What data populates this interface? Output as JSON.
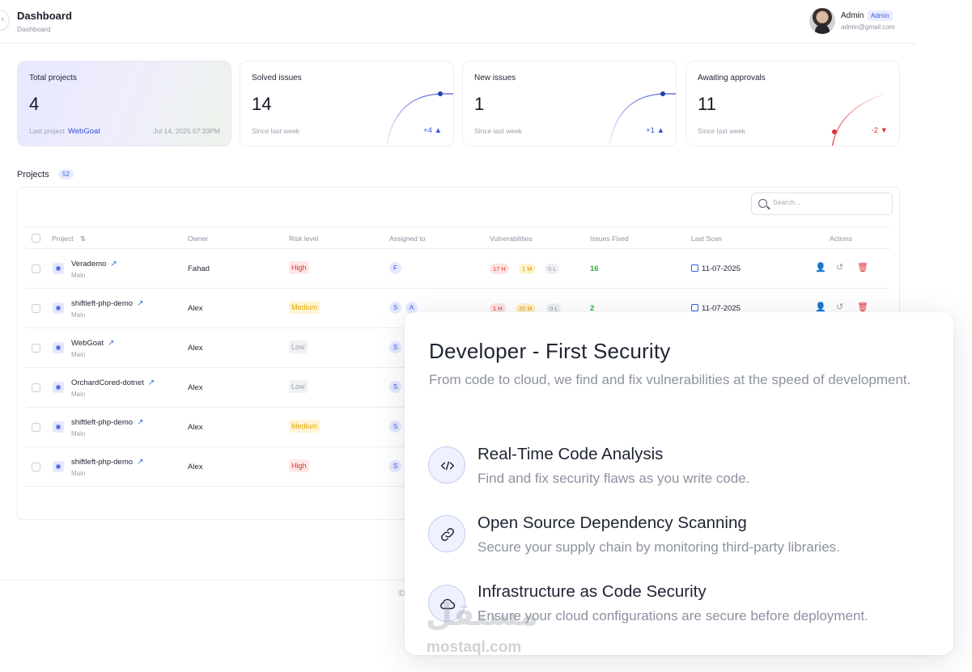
{
  "header": {
    "back_glyph": "‹",
    "title": "Dashboard",
    "breadcrumb": "Dashboard",
    "user": {
      "name": "Admin",
      "role_badge": "Admin",
      "email": "admin@gmail.com"
    }
  },
  "stats": {
    "total": {
      "label": "Total projects",
      "value": "4",
      "last_label": "Last project",
      "last_link": "WebGoat",
      "date": "Jul 14, 2025 07:33PM"
    },
    "solved": {
      "label": "Solved issues",
      "value": "14",
      "sub": "Since last week",
      "delta": "+4 ▲",
      "accent": "#3b4fd8"
    },
    "new": {
      "label": "New issues",
      "value": "1",
      "sub": "Since last week",
      "delta": "+1 ▲",
      "accent": "#3b4fd8"
    },
    "awaiting": {
      "label": "Awaiting approvals",
      "value": "11",
      "sub": "Since last week",
      "delta": "-2 ▼",
      "accent": "#e03131"
    }
  },
  "projects": {
    "title": "Projects",
    "count": "52",
    "search_placeholder": "Search...",
    "columns": {
      "project": "Project",
      "sort_icon": "⇅",
      "owner": "Owner",
      "risk": "Risk level",
      "assigned": "Assigned to",
      "vulns": "Vulnerabilities",
      "fixed": "Issues Fixed",
      "scan": "Last Scan",
      "actions": "Actions"
    },
    "rows": [
      {
        "name": "Verademo",
        "branch": "Main",
        "owner": "Fahad",
        "risk": "High",
        "assigned": [
          "F"
        ],
        "vuln_h": "17 H",
        "vuln_m": "1 M",
        "vuln_l": "0 L",
        "fixed": "16",
        "scan": "11-07-2025"
      },
      {
        "name": "shiftleft-php-demo",
        "branch": "Main",
        "owner": "Alex",
        "risk": "Medium",
        "assigned": [
          "S",
          "A"
        ],
        "vuln_h": "1 H",
        "vuln_m": "20 M",
        "vuln_l": "0 L",
        "fixed": "2",
        "scan": "11-07-2025"
      },
      {
        "name": "WebGoat",
        "branch": "Main",
        "owner": "Alex",
        "risk": "Low",
        "assigned": [
          "S"
        ]
      },
      {
        "name": "OrchardCored-dotnet",
        "branch": "Main",
        "owner": "Alex",
        "risk": "Low",
        "assigned": [
          "S"
        ]
      },
      {
        "name": "shiftleft-php-demo",
        "branch": "Main",
        "owner": "Alex",
        "risk": "Medium",
        "assigned": [
          "S"
        ]
      },
      {
        "name": "shiftleft-php-demo",
        "branch": "Main",
        "owner": "Alex",
        "risk": "High",
        "assigned": [
          "S"
        ]
      }
    ]
  },
  "footer": {
    "fragment": "©"
  },
  "overlay": {
    "title": "Developer - First Security",
    "subtitle": "From code to cloud, we find and fix vulnerabilities at the speed of development.",
    "features": [
      {
        "icon": "code-icon",
        "title": "Real-Time Code Analysis",
        "desc": "Find and fix security flaws as you write code."
      },
      {
        "icon": "link-icon",
        "title": "Open Source Dependency Scanning",
        "desc": "Secure your supply chain by monitoring third-party libraries."
      },
      {
        "icon": "cloud-icon",
        "title": "Infrastructure as Code Security",
        "desc": "Ensure your cloud configurations are secure before deployment."
      }
    ]
  },
  "watermark": {
    "arabic": "مستقل",
    "latin": "mostaql.com"
  }
}
